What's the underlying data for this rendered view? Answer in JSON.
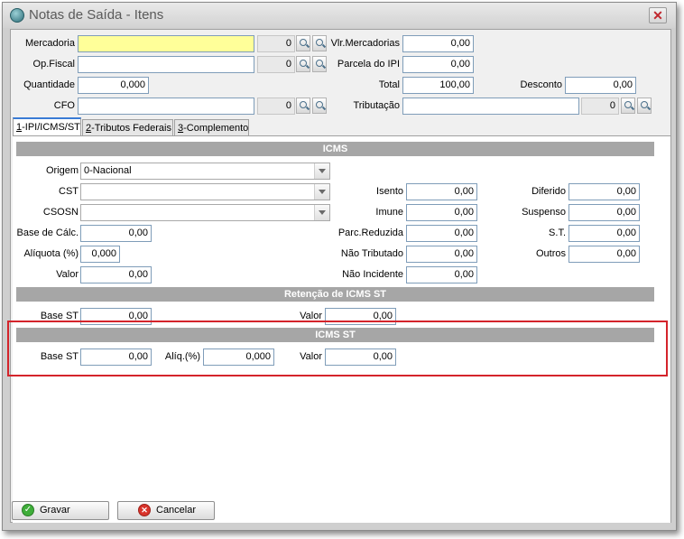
{
  "window": {
    "title": "Notas de Saída - Itens",
    "close_glyph": "✕"
  },
  "header": {
    "mercadoria": {
      "label": "Mercadoria",
      "value": "",
      "code": "0"
    },
    "op_fiscal": {
      "label": "Op.Fiscal",
      "value": "",
      "code": "0"
    },
    "quantidade": {
      "label": "Quantidade",
      "value": "0,000"
    },
    "cfo": {
      "label": "CFO",
      "value": "",
      "code": "0"
    },
    "vlr_mercadorias": {
      "label": "Vlr.Mercadorias",
      "value": "0,00"
    },
    "parcela_ipi": {
      "label": "Parcela do IPI",
      "value": "0,00"
    },
    "total": {
      "label": "Total",
      "value": "100,00"
    },
    "tributacao": {
      "label": "Tributação",
      "value": "",
      "code": "0"
    },
    "desconto": {
      "label": "Desconto",
      "value": "0,00"
    }
  },
  "tabs": [
    {
      "accel": "1",
      "label": "-IPI/ICMS/ST"
    },
    {
      "accel": "2",
      "label": "-Tributos Federais"
    },
    {
      "accel": "3",
      "label": "-Complemento"
    }
  ],
  "icms": {
    "header": "ICMS",
    "origem": {
      "label": "Origem",
      "value": "0-Nacional"
    },
    "cst": {
      "label": "CST",
      "value": ""
    },
    "csosn": {
      "label": "CSOSN",
      "value": ""
    },
    "base_calc": {
      "label": "Base de Cálc.",
      "value": "0,00"
    },
    "aliquota": {
      "label": "Alíquota (%)",
      "value": "0,000"
    },
    "valor": {
      "label": "Valor",
      "value": "0,00"
    },
    "isento": {
      "label": "Isento",
      "value": "0,00"
    },
    "imune": {
      "label": "Imune",
      "value": "0,00"
    },
    "parc_reduzida": {
      "label": "Parc.Reduzida",
      "value": "0,00"
    },
    "nao_tributado": {
      "label": "Não Tributado",
      "value": "0,00"
    },
    "nao_incidente": {
      "label": "Não Incidente",
      "value": "0,00"
    },
    "diferido": {
      "label": "Diferido",
      "value": "0,00"
    },
    "suspenso": {
      "label": "Suspenso",
      "value": "0,00"
    },
    "st": {
      "label": "S.T.",
      "value": "0,00"
    },
    "outros": {
      "label": "Outros",
      "value": "0,00"
    }
  },
  "retencao": {
    "header": "Retenção de ICMS ST",
    "base_st": {
      "label": "Base ST",
      "value": "0,00"
    },
    "valor": {
      "label": "Valor",
      "value": "0,00"
    }
  },
  "icms_st": {
    "header": "ICMS ST",
    "base_st": {
      "label": "Base ST",
      "value": "0,00"
    },
    "aliq": {
      "label": "Alíq.(%)",
      "value": "0,000"
    },
    "valor": {
      "label": "Valor",
      "value": "0,00"
    },
    "highlight_color": "#d4242b"
  },
  "buttons": {
    "gravar": "Gravar",
    "cancelar": "Cancelar",
    "gravar_glyph": "✓",
    "cancelar_glyph": "✕"
  }
}
